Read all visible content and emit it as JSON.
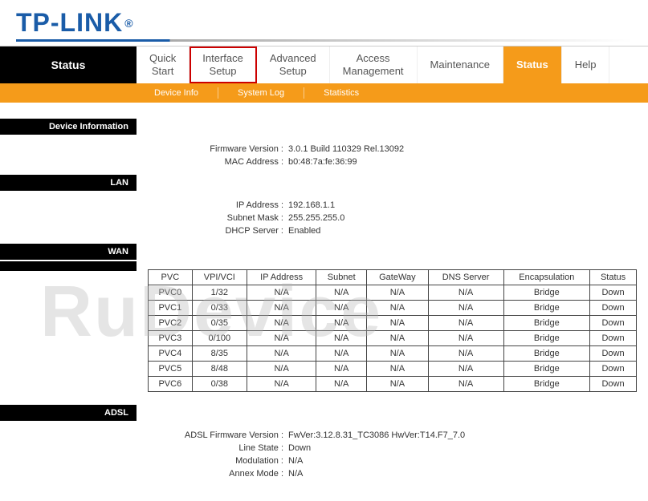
{
  "logo": {
    "text": "TP-LINK",
    "reg": "®"
  },
  "topnav": {
    "status_label": "Status",
    "items": [
      {
        "l1": "Quick",
        "l2": "Start"
      },
      {
        "l1": "Interface",
        "l2": "Setup"
      },
      {
        "l1": "Advanced",
        "l2": "Setup"
      },
      {
        "l1": "Access",
        "l2": "Management"
      },
      {
        "l1": "Maintenance",
        "l2": ""
      },
      {
        "l1": "Status",
        "l2": ""
      },
      {
        "l1": "Help",
        "l2": ""
      }
    ]
  },
  "subnav": {
    "items": [
      "Device Info",
      "System Log",
      "Statistics"
    ]
  },
  "sections": {
    "device_info": "Device Information",
    "lan": "LAN",
    "wan": "WAN",
    "adsl": "ADSL"
  },
  "device_info": {
    "firmware_label": "Firmware Version :",
    "firmware_value": "3.0.1 Build 110329 Rel.13092",
    "mac_label": "MAC Address :",
    "mac_value": "b0:48:7a:fe:36:99"
  },
  "lan": {
    "ip_label": "IP Address :",
    "ip_value": "192.168.1.1",
    "subnet_label": "Subnet Mask :",
    "subnet_value": "255.255.255.0",
    "dhcp_label": "DHCP Server :",
    "dhcp_value": "Enabled"
  },
  "wan": {
    "headers": [
      "PVC",
      "VPI/VCI",
      "IP Address",
      "Subnet",
      "GateWay",
      "DNS Server",
      "Encapsulation",
      "Status"
    ],
    "rows": [
      [
        "PVC0",
        "1/32",
        "N/A",
        "N/A",
        "N/A",
        "N/A",
        "Bridge",
        "Down"
      ],
      [
        "PVC1",
        "0/33",
        "N/A",
        "N/A",
        "N/A",
        "N/A",
        "Bridge",
        "Down"
      ],
      [
        "PVC2",
        "0/35",
        "N/A",
        "N/A",
        "N/A",
        "N/A",
        "Bridge",
        "Down"
      ],
      [
        "PVC3",
        "0/100",
        "N/A",
        "N/A",
        "N/A",
        "N/A",
        "Bridge",
        "Down"
      ],
      [
        "PVC4",
        "8/35",
        "N/A",
        "N/A",
        "N/A",
        "N/A",
        "Bridge",
        "Down"
      ],
      [
        "PVC5",
        "8/48",
        "N/A",
        "N/A",
        "N/A",
        "N/A",
        "Bridge",
        "Down"
      ],
      [
        "PVC6",
        "0/38",
        "N/A",
        "N/A",
        "N/A",
        "N/A",
        "Bridge",
        "Down"
      ]
    ]
  },
  "adsl": {
    "fw_label": "ADSL Firmware Version :",
    "fw_value": "FwVer:3.12.8.31_TC3086 HwVer:T14.F7_7.0",
    "line_label": "Line State :",
    "line_value": "Down",
    "mod_label": "Modulation :",
    "mod_value": "N/A",
    "annex_label": "Annex Mode :",
    "annex_value": "N/A"
  },
  "watermark": "RuDevice"
}
